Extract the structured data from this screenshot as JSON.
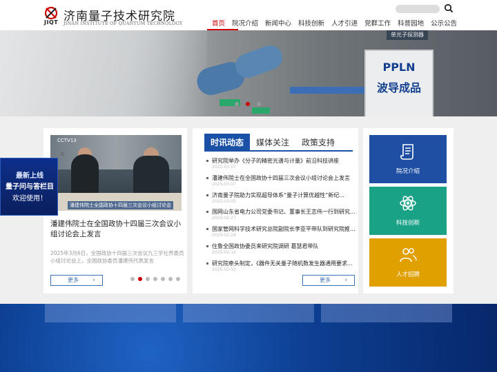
{
  "site": {
    "logo_abbr": "JIQT",
    "name_cn": "济南量子技术研究院",
    "name_en": "JINAN INSTITUTE OF QUANTUM TECHNOLOGY"
  },
  "nav": {
    "items": [
      "首页",
      "院况介绍",
      "新闻中心",
      "科技创新",
      "人才引进",
      "党群工作",
      "科普园地",
      "公示公告"
    ],
    "active_index": 0
  },
  "banner": {
    "sign_line1": "PPLN",
    "sign_line2": "波导成品",
    "top_sign": "单光子探测器",
    "slide_count": 3,
    "active_slide": 1
  },
  "featured": {
    "photo_logo": "CCTV13",
    "photo_caption": "潘建伟院士全国政协十四届三次会议小组讨论会",
    "headline": "潘建伟院士在全国政协十四届三次会议小组讨论会上发言",
    "summary": "2025年3月6日，全国政协十四届三次会议九三学社界委员小组讨论会上，全国政协委员潘建伟代表发言",
    "more_label": "更多",
    "more_arrow": "›",
    "slide_count": 7,
    "active_slide": 1
  },
  "popup": {
    "line1": "最新上线",
    "line2": "量子问与答栏目",
    "line3": "欢迎使用！",
    "close": "✕"
  },
  "news_tabs": {
    "tabs": [
      "时讯动态",
      "媒体关注",
      "政策支持"
    ],
    "active_index": 0,
    "more_label": "更多",
    "more_arrow": "›",
    "items": [
      {
        "title": "研究院举办《分子的精密光谱与计量》前沿科技讲座",
        "date": "2025-03-07"
      },
      {
        "title": "潘建伟院士在全国政协十四届三次会议小组讨论会上发言",
        "date": "2025-03-07"
      },
      {
        "title": "济南量子院助力实现超导体系“量子计算优越性”新纪...",
        "date": "2025-03-05"
      },
      {
        "title": "国网山东省电力公司党委书记、董事长王志伟一行到研究...",
        "date": "2025-02-27"
      },
      {
        "title": "国家管网科学技术研究总院副院长李亚平带队到研究院推...",
        "date": "2025-02-24"
      },
      {
        "title": "住鲁全国政协委员来研究院调研 葛慧君带队",
        "date": "2025-02-12"
      },
      {
        "title": "研究院牵头制定，《器件无关量子随机数发生器通用要求...",
        "date": "2025-02-12"
      }
    ]
  },
  "quick_links": [
    {
      "label": "院况介绍",
      "icon": "document-scroll-icon",
      "color": "#1f4fa3"
    },
    {
      "label": "科技创新",
      "icon": "atom-icon",
      "color": "#1aa287"
    },
    {
      "label": "人才招聘",
      "icon": "people-icon",
      "color": "#e0a000"
    }
  ]
}
